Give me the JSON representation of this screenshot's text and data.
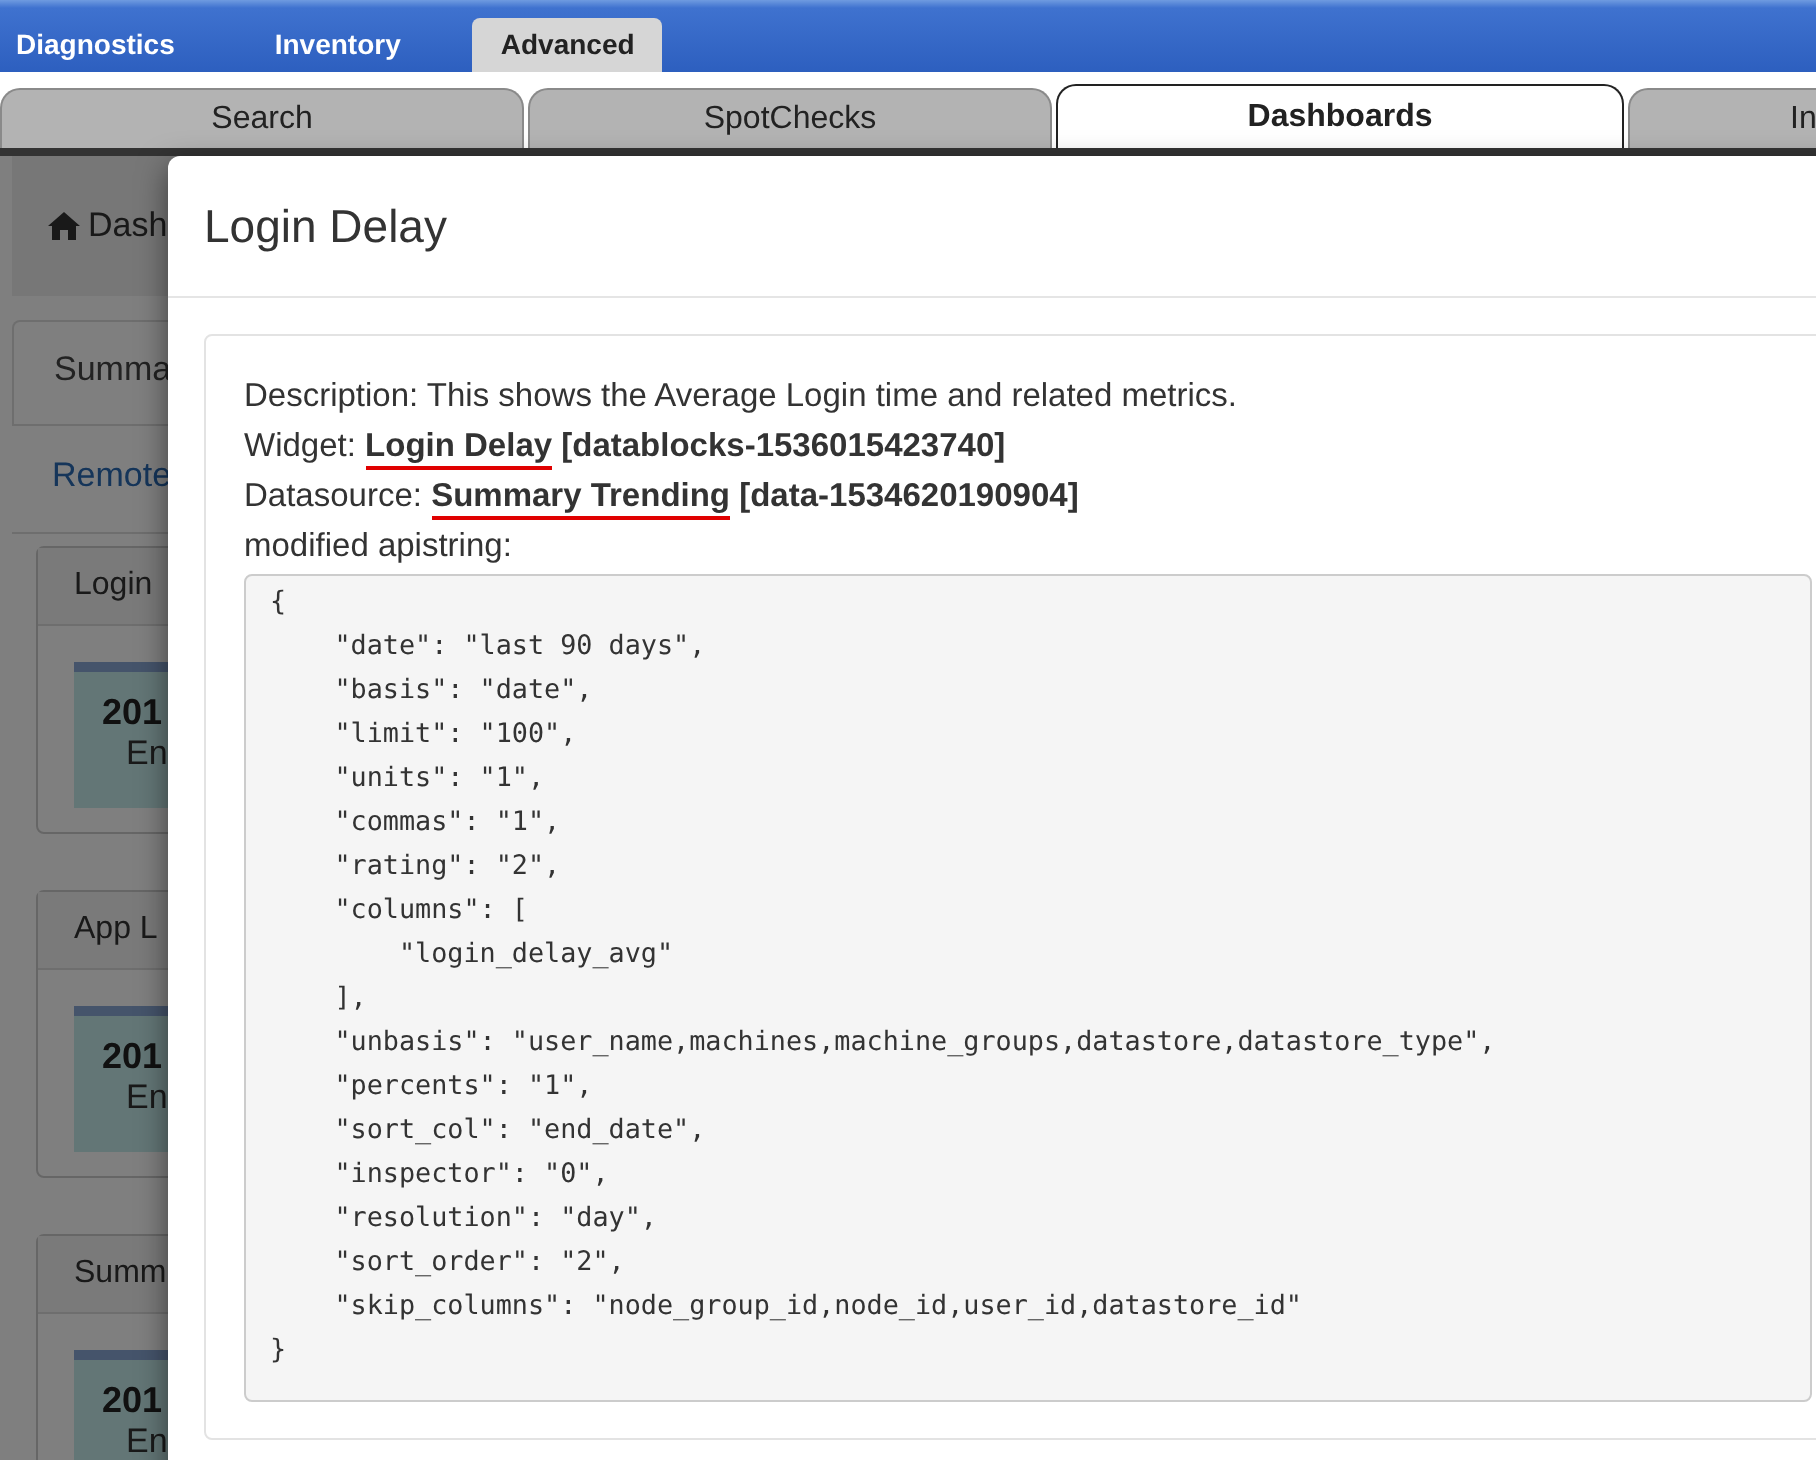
{
  "top_tabs": [
    {
      "label": "Diagnostics",
      "selected": false
    },
    {
      "label": "Inventory",
      "selected": false
    },
    {
      "label": "Advanced",
      "selected": true
    }
  ],
  "sub_tabs": [
    {
      "label": "Search",
      "selected": false
    },
    {
      "label": "SpotChecks",
      "selected": false
    },
    {
      "label": "Dashboards",
      "selected": true
    },
    {
      "label": "In",
      "selected": false
    }
  ],
  "background_page": {
    "breadcrumb": "Dash",
    "panel_tab": "Summa",
    "link": "Remote",
    "cards": [
      {
        "title": "Login",
        "tile_value": "201",
        "tile_label": "En"
      },
      {
        "title": "App L",
        "tile_value": "201",
        "tile_label": "En"
      },
      {
        "title": "Summ",
        "tile_value": "201",
        "tile_label": "En"
      }
    ]
  },
  "modal": {
    "title": "Login Delay",
    "description": {
      "label": "Description:",
      "text": "This shows the Average Login time and related metrics."
    },
    "widget": {
      "label": "Widget:",
      "name": "Login Delay",
      "ref": "[datablocks-1536015423740]",
      "underlined": true
    },
    "datasource": {
      "label": "Datasource:",
      "name": "Summary Trending",
      "ref": "[data-1534620190904]",
      "underlined": true
    },
    "apistring_label": "modified apistring:",
    "code_lines": [
      "{",
      "    \"date\": \"last 90 days\",",
      "    \"basis\": \"date\",",
      "    \"limit\": \"100\",",
      "    \"units\": \"1\",",
      "    \"commas\": \"1\",",
      "    \"rating\": \"2\",",
      "    \"columns\": [",
      "        \"login_delay_avg\"",
      "    ],",
      "    \"unbasis\": \"user_name,machines,machine_groups,datastore,datastore_type\",",
      "    \"percents\": \"1\",",
      "    \"sort_col\": \"end_date\",",
      "    \"inspector\": \"0\",",
      "    \"resolution\": \"day\",",
      "    \"sort_order\": \"2\",",
      "    \"skip_columns\": \"node_group_id,node_id,user_id,datastore_id\"",
      "}"
    ]
  }
}
